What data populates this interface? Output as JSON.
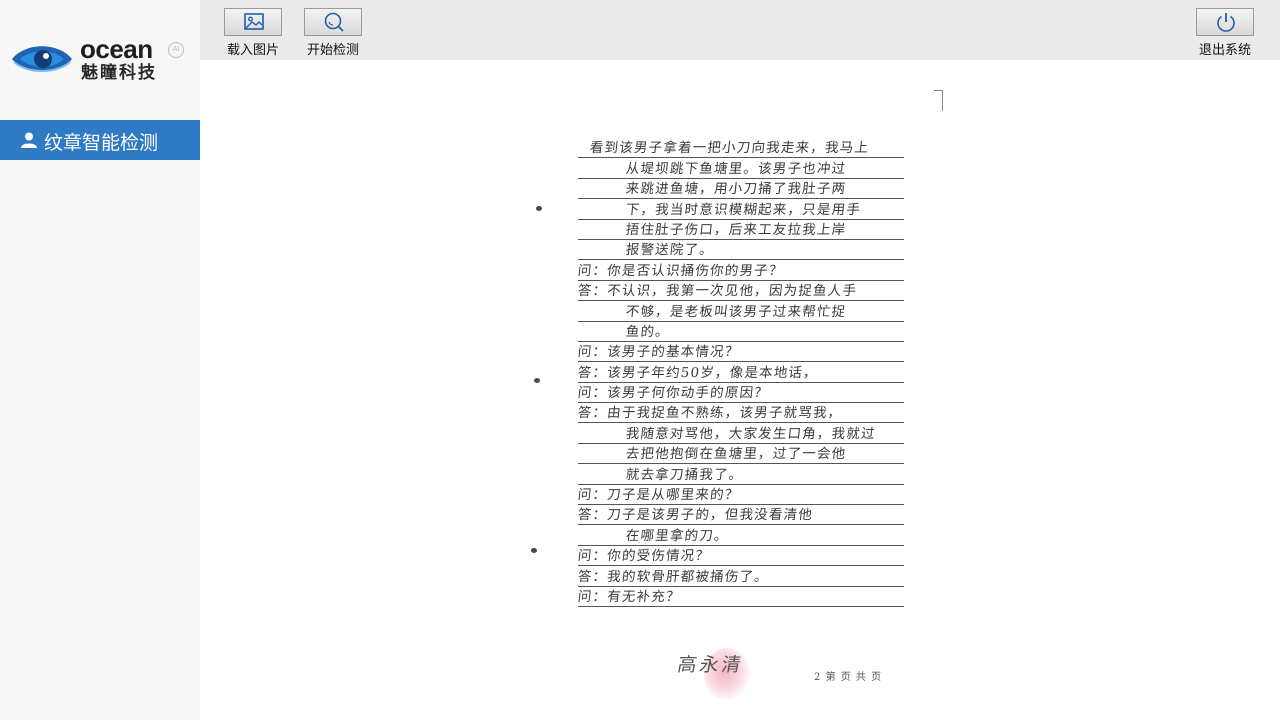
{
  "brand": {
    "logo_word": "ocean",
    "logo_badge": "AI",
    "logo_cn": "魅瞳科技",
    "accent_color": "#2e7ac4"
  },
  "sidebar": {
    "items": [
      {
        "label": "纹章智能检测",
        "icon": "user-icon",
        "active": true
      }
    ]
  },
  "toolbar": {
    "load_image_label": "载入图片",
    "load_image_icon": "image-icon",
    "start_detect_label": "开始检测",
    "start_detect_icon": "search-icon",
    "exit_label": "退出系统",
    "exit_icon": "power-icon"
  },
  "document": {
    "lines": [
      {
        "kind": "first",
        "text": "看到该男子拿着一把小刀向我走来，我马上"
      },
      {
        "kind": "cont",
        "text": "从堤坝跳下鱼塘里。该男子也冲过"
      },
      {
        "kind": "cont",
        "text": "来跳进鱼塘，用小刀捅了我肚子两"
      },
      {
        "kind": "cont",
        "text": "下，我当时意识模糊起来，只是用手"
      },
      {
        "kind": "cont",
        "text": "捂住肚子伤口，后来工友拉我上岸"
      },
      {
        "kind": "cont",
        "text": "报警送院了。"
      },
      {
        "kind": "qa",
        "text": "问：你是否认识捅伤你的男子？"
      },
      {
        "kind": "qa",
        "text": "答：不认识，我第一次见他，因为捉鱼人手"
      },
      {
        "kind": "cont",
        "text": "不够，是老板叫该男子过来帮忙捉"
      },
      {
        "kind": "cont",
        "text": "鱼的。"
      },
      {
        "kind": "qa",
        "text": "问：该男子的基本情况？"
      },
      {
        "kind": "qa",
        "text": "答：该男子年约50岁，像是本地话，"
      },
      {
        "kind": "qa",
        "text": "问：该男子何你动手的原因？"
      },
      {
        "kind": "qa",
        "text": "答：由于我捉鱼不熟练，该男子就骂我，"
      },
      {
        "kind": "cont",
        "text": "我随意对骂他，大家发生口角，我就过"
      },
      {
        "kind": "cont",
        "text": "去把他抱倒在鱼塘里，过了一会他"
      },
      {
        "kind": "cont",
        "text": "就去拿刀捅我了。"
      },
      {
        "kind": "qa",
        "text": "问：刀子是从哪里来的？"
      },
      {
        "kind": "qa",
        "text": "答：刀子是该男子的，但我没看清他"
      },
      {
        "kind": "cont",
        "text": "在哪里拿的刀。"
      },
      {
        "kind": "qa",
        "text": "问：你的受伤情况？"
      },
      {
        "kind": "qa",
        "text": "答：我的软骨肝都被捅伤了。"
      },
      {
        "kind": "qa",
        "text": "问：有无补充？"
      }
    ],
    "signature": "高永清",
    "page_label": "第 页 共 页",
    "page_number": "2"
  }
}
